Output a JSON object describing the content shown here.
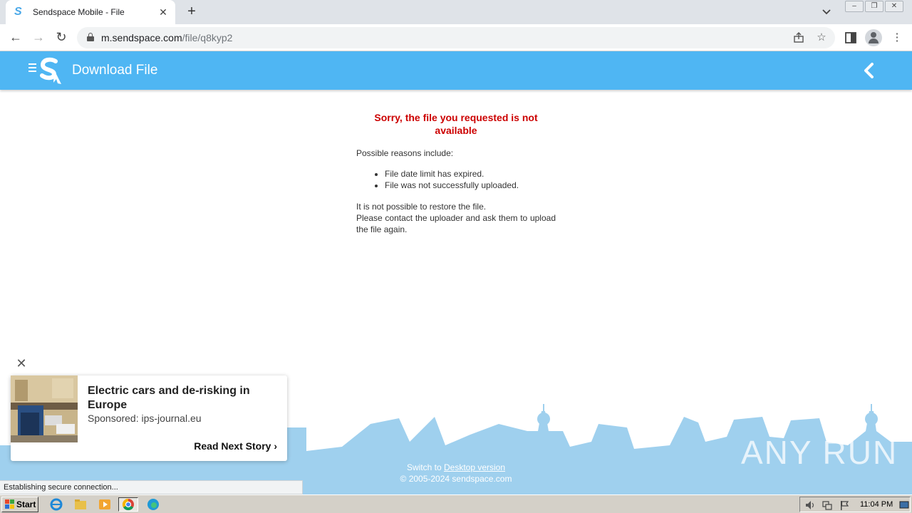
{
  "browser": {
    "tab_title": "Sendspace Mobile - File",
    "tab_favicon": "S",
    "url_host": "m.sendspace.com",
    "url_path": "/file/q8kyp2",
    "status_text": "Establishing secure connection..."
  },
  "header": {
    "logo_letter": "S",
    "title": "Download File"
  },
  "content": {
    "error_title": "Sorry, the file you requested is not available",
    "reasons_intro": "Possible reasons include:",
    "reasons": [
      "File date limit has expired.",
      "File was not successfully uploaded."
    ],
    "restore_line1": "It is not possible to restore the file.",
    "restore_line2": "Please contact the uploader and ask them to upload the file again."
  },
  "footer": {
    "switch_prefix": "Switch to ",
    "switch_link": "Desktop version",
    "copyright": "© 2005-2024 sendspace.com",
    "watermark": "ANY RUN"
  },
  "ad": {
    "close_glyph": "✕",
    "headline": "Electric cars and de-risking in Europe",
    "sponsor": "Sponsored: ips-journal.eu",
    "cta": "Read Next Story",
    "cta_glyph": "›"
  },
  "taskbar": {
    "start_label": "Start",
    "clock": "11:04 PM"
  },
  "colors": {
    "header_blue": "#4fb6f3",
    "skyline_blue": "#9fd0ee",
    "error_red": "#cc0000"
  }
}
